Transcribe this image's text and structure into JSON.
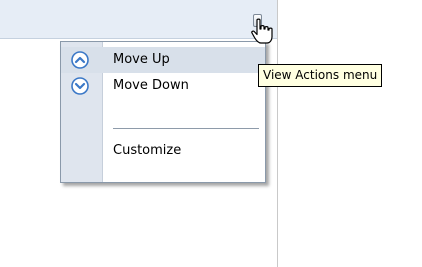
{
  "menu": {
    "items": [
      {
        "label": "Move Up",
        "icon": "chevron-up-circle-icon"
      },
      {
        "label": "Move Down",
        "icon": "chevron-down-circle-icon"
      },
      {
        "label": "Customize",
        "icon": ""
      }
    ]
  },
  "tooltip": {
    "text": "View Actions menu"
  },
  "colors": {
    "header_background": "#e6edf6",
    "menu_gutter": "#dfe5ee",
    "menu_hover": "#d8e0ea",
    "icon_blue": "#3b78c7",
    "tooltip_background": "#ffffe1"
  }
}
